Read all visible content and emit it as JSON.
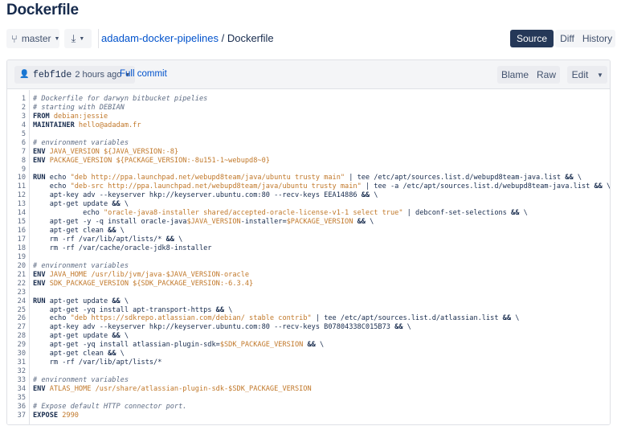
{
  "page": {
    "title": "Dockerfile"
  },
  "toolbar": {
    "branch_label": "master",
    "branch_icon": "branch-icon",
    "clone_icon": "download-icon",
    "repo_link": "adadam-docker-pipelines",
    "crumb_separator": " / ",
    "file_name": "Dockerfile",
    "tabs": {
      "source": "Source",
      "diff": "Diff",
      "history": "History"
    },
    "active_tab": "Source"
  },
  "commit": {
    "hash": "febf1de",
    "time": "2 hours ago",
    "full_commit_link": "Full commit",
    "blame": "Blame",
    "raw": "Raw",
    "edit": "Edit"
  },
  "colors": {
    "accent": "#0052cc",
    "active_tab_bg": "#253858",
    "string": "#c1782a",
    "comment": "#5e6c84"
  },
  "code": [
    [
      {
        "t": "comment",
        "v": "# Dockerfile for darwyn bitbucket pipelies"
      }
    ],
    [
      {
        "t": "comment",
        "v": "# starting with DEBIAN"
      }
    ],
    [
      {
        "t": "kw",
        "v": "FROM "
      },
      {
        "t": "str",
        "v": "debian:jessie"
      }
    ],
    [
      {
        "t": "kw",
        "v": "MAINTAINER "
      },
      {
        "t": "str",
        "v": "hello@adadam.fr"
      }
    ],
    [],
    [
      {
        "t": "comment",
        "v": "# environment variables"
      }
    ],
    [
      {
        "t": "kw",
        "v": "ENV "
      },
      {
        "t": "str",
        "v": "JAVA_VERSION ${JAVA_VERSION:-8}"
      }
    ],
    [
      {
        "t": "kw",
        "v": "ENV "
      },
      {
        "t": "str",
        "v": "PACKAGE_VERSION ${PACKAGE_VERSION:-8u151-1~webupd8~0}"
      }
    ],
    [],
    [
      {
        "t": "kw",
        "v": "RUN "
      },
      {
        "t": "plain",
        "v": "echo "
      },
      {
        "t": "str",
        "v": "\"deb http://ppa.launchpad.net/webupd8team/java/ubuntu trusty main\""
      },
      {
        "t": "plain",
        "v": " | tee /etc/apt/sources.list.d/webupd8team-java.list "
      },
      {
        "t": "op",
        "v": "&&"
      },
      {
        "t": "plain",
        "v": " \\"
      }
    ],
    [
      {
        "t": "plain",
        "v": "    echo "
      },
      {
        "t": "str",
        "v": "\"deb-src http://ppa.launchpad.net/webupd8team/java/ubuntu trusty main\""
      },
      {
        "t": "plain",
        "v": " | tee -a /etc/apt/sources.list.d/webupd8team-java.list "
      },
      {
        "t": "op",
        "v": "&&"
      },
      {
        "t": "plain",
        "v": " \\"
      }
    ],
    [
      {
        "t": "plain",
        "v": "    apt-key adv --keyserver hkp://keyserver.ubuntu.com:80 --recv-keys EEA14886 "
      },
      {
        "t": "op",
        "v": "&&"
      },
      {
        "t": "plain",
        "v": " \\"
      }
    ],
    [
      {
        "t": "plain",
        "v": "    apt-get update "
      },
      {
        "t": "op",
        "v": "&&"
      },
      {
        "t": "plain",
        "v": " \\"
      }
    ],
    [
      {
        "t": "plain",
        "v": "            echo "
      },
      {
        "t": "str",
        "v": "\"oracle-java8-installer shared/accepted-oracle-license-v1-1 select true\""
      },
      {
        "t": "plain",
        "v": " | debconf-set-selections "
      },
      {
        "t": "op",
        "v": "&&"
      },
      {
        "t": "plain",
        "v": " \\"
      }
    ],
    [
      {
        "t": "plain",
        "v": "    apt-get -y -q install oracle-java"
      },
      {
        "t": "var",
        "v": "$JAVA_VERSION"
      },
      {
        "t": "plain",
        "v": "-installer="
      },
      {
        "t": "var",
        "v": "$PACKAGE_VERSION"
      },
      {
        "t": "plain",
        "v": " "
      },
      {
        "t": "op",
        "v": "&&"
      },
      {
        "t": "plain",
        "v": " \\"
      }
    ],
    [
      {
        "t": "plain",
        "v": "    apt-get clean "
      },
      {
        "t": "op",
        "v": "&&"
      },
      {
        "t": "plain",
        "v": " \\"
      }
    ],
    [
      {
        "t": "plain",
        "v": "    rm -rf /var/lib/apt/lists/* "
      },
      {
        "t": "op",
        "v": "&&"
      },
      {
        "t": "plain",
        "v": " \\"
      }
    ],
    [
      {
        "t": "plain",
        "v": "    rm -rf /var/cache/oracle-jdk8-installer"
      }
    ],
    [],
    [
      {
        "t": "comment",
        "v": "# environment variables"
      }
    ],
    [
      {
        "t": "kw",
        "v": "ENV "
      },
      {
        "t": "str",
        "v": "JAVA_HOME /usr/lib/jvm/java-$JAVA_VERSION-oracle"
      }
    ],
    [
      {
        "t": "kw",
        "v": "ENV "
      },
      {
        "t": "str",
        "v": "SDK_PACKAGE_VERSION ${SDK_PACKAGE_VERSION:-6.3.4}"
      }
    ],
    [],
    [
      {
        "t": "kw",
        "v": "RUN "
      },
      {
        "t": "plain",
        "v": "apt-get update "
      },
      {
        "t": "op",
        "v": "&&"
      },
      {
        "t": "plain",
        "v": " \\"
      }
    ],
    [
      {
        "t": "plain",
        "v": "    apt-get -yq install apt-transport-https "
      },
      {
        "t": "op",
        "v": "&&"
      },
      {
        "t": "plain",
        "v": " \\"
      }
    ],
    [
      {
        "t": "plain",
        "v": "    echo "
      },
      {
        "t": "str",
        "v": "\"deb https://sdkrepo.atlassian.com/debian/ stable contrib\""
      },
      {
        "t": "plain",
        "v": " | tee /etc/apt/sources.list.d/atlassian.list "
      },
      {
        "t": "op",
        "v": "&&"
      },
      {
        "t": "plain",
        "v": " \\"
      }
    ],
    [
      {
        "t": "plain",
        "v": "    apt-key adv --keyserver hkp://keyserver.ubuntu.com:80 --recv-keys B07804338C015B73 "
      },
      {
        "t": "op",
        "v": "&&"
      },
      {
        "t": "plain",
        "v": " \\"
      }
    ],
    [
      {
        "t": "plain",
        "v": "    apt-get update "
      },
      {
        "t": "op",
        "v": "&&"
      },
      {
        "t": "plain",
        "v": " \\"
      }
    ],
    [
      {
        "t": "plain",
        "v": "    apt-get -yq install atlassian-plugin-sdk="
      },
      {
        "t": "var",
        "v": "$SDK_PACKAGE_VERSION"
      },
      {
        "t": "plain",
        "v": " "
      },
      {
        "t": "op",
        "v": "&&"
      },
      {
        "t": "plain",
        "v": " \\"
      }
    ],
    [
      {
        "t": "plain",
        "v": "    apt-get clean "
      },
      {
        "t": "op",
        "v": "&&"
      },
      {
        "t": "plain",
        "v": " \\"
      }
    ],
    [
      {
        "t": "plain",
        "v": "    rm -rf /var/lib/apt/lists/*"
      }
    ],
    [],
    [
      {
        "t": "comment",
        "v": "# environment variables"
      }
    ],
    [
      {
        "t": "kw",
        "v": "ENV "
      },
      {
        "t": "str",
        "v": "ATLAS_HOME /usr/share/atlassian-plugin-sdk-$SDK_PACKAGE_VERSION"
      }
    ],
    [],
    [
      {
        "t": "comment",
        "v": "# Expose default HTTP connector port."
      }
    ],
    [
      {
        "t": "kw",
        "v": "EXPOSE "
      },
      {
        "t": "str",
        "v": "2990"
      }
    ]
  ]
}
